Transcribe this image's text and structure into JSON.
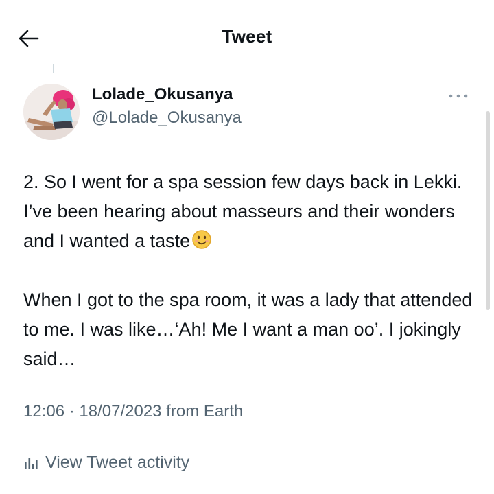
{
  "header": {
    "title": "Tweet",
    "back_icon": "arrow-left-icon"
  },
  "author": {
    "display_name": "Lolade_Okusanya",
    "handle": "@Lolade_Okusanya",
    "avatar_colors": {
      "hair": "#e8337a",
      "outfit": "#8fd3e8",
      "skin": "#b98a6b"
    }
  },
  "tweet": {
    "paragraph1": "2. So I went for a spa session few days back in Lekki. I’ve been hearing about masseurs and their wonders and I wanted a taste",
    "emoji": "smiling-face-emoji",
    "paragraph2": "When I got to the spa room, it was a lady that attended to me. I was like…‘Ah! Me I want a man oo’. I jokingly said…"
  },
  "meta": {
    "time": "12:06",
    "separator": " · ",
    "date": "18/07/2023",
    "source": " from Earth"
  },
  "activity": {
    "label": "View Tweet activity",
    "icon": "bar-chart-icon"
  },
  "colors": {
    "text": "#0f1419",
    "secondary": "#536471",
    "divider": "#e1e8ed"
  }
}
